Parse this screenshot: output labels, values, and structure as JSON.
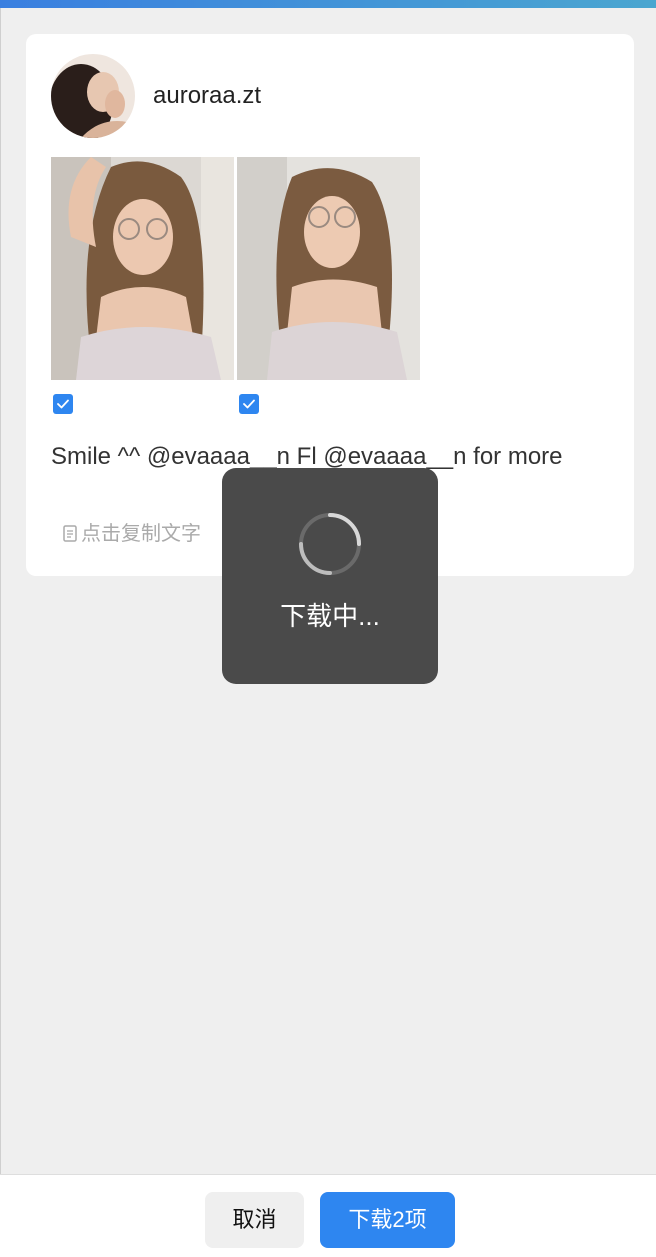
{
  "post": {
    "username": "auroraa.zt",
    "caption": "Smile ^^ @evaaaa__n Fl @evaaaa__n for more",
    "copy_text_label": "点击复制文字",
    "photos": [
      {
        "name": "photo-1",
        "selected": true
      },
      {
        "name": "photo-2",
        "selected": true
      }
    ]
  },
  "toast": {
    "message": "下载中..."
  },
  "footer": {
    "cancel_label": "取消",
    "download_label": "下载2项"
  },
  "colors": {
    "accent": "#2e86f0",
    "toast_bg": "#4a4a4a",
    "page_bg": "#efefef"
  },
  "icons": {
    "copy": "copy-icon",
    "check": "check-icon",
    "spinner": "loading-spinner-icon"
  }
}
